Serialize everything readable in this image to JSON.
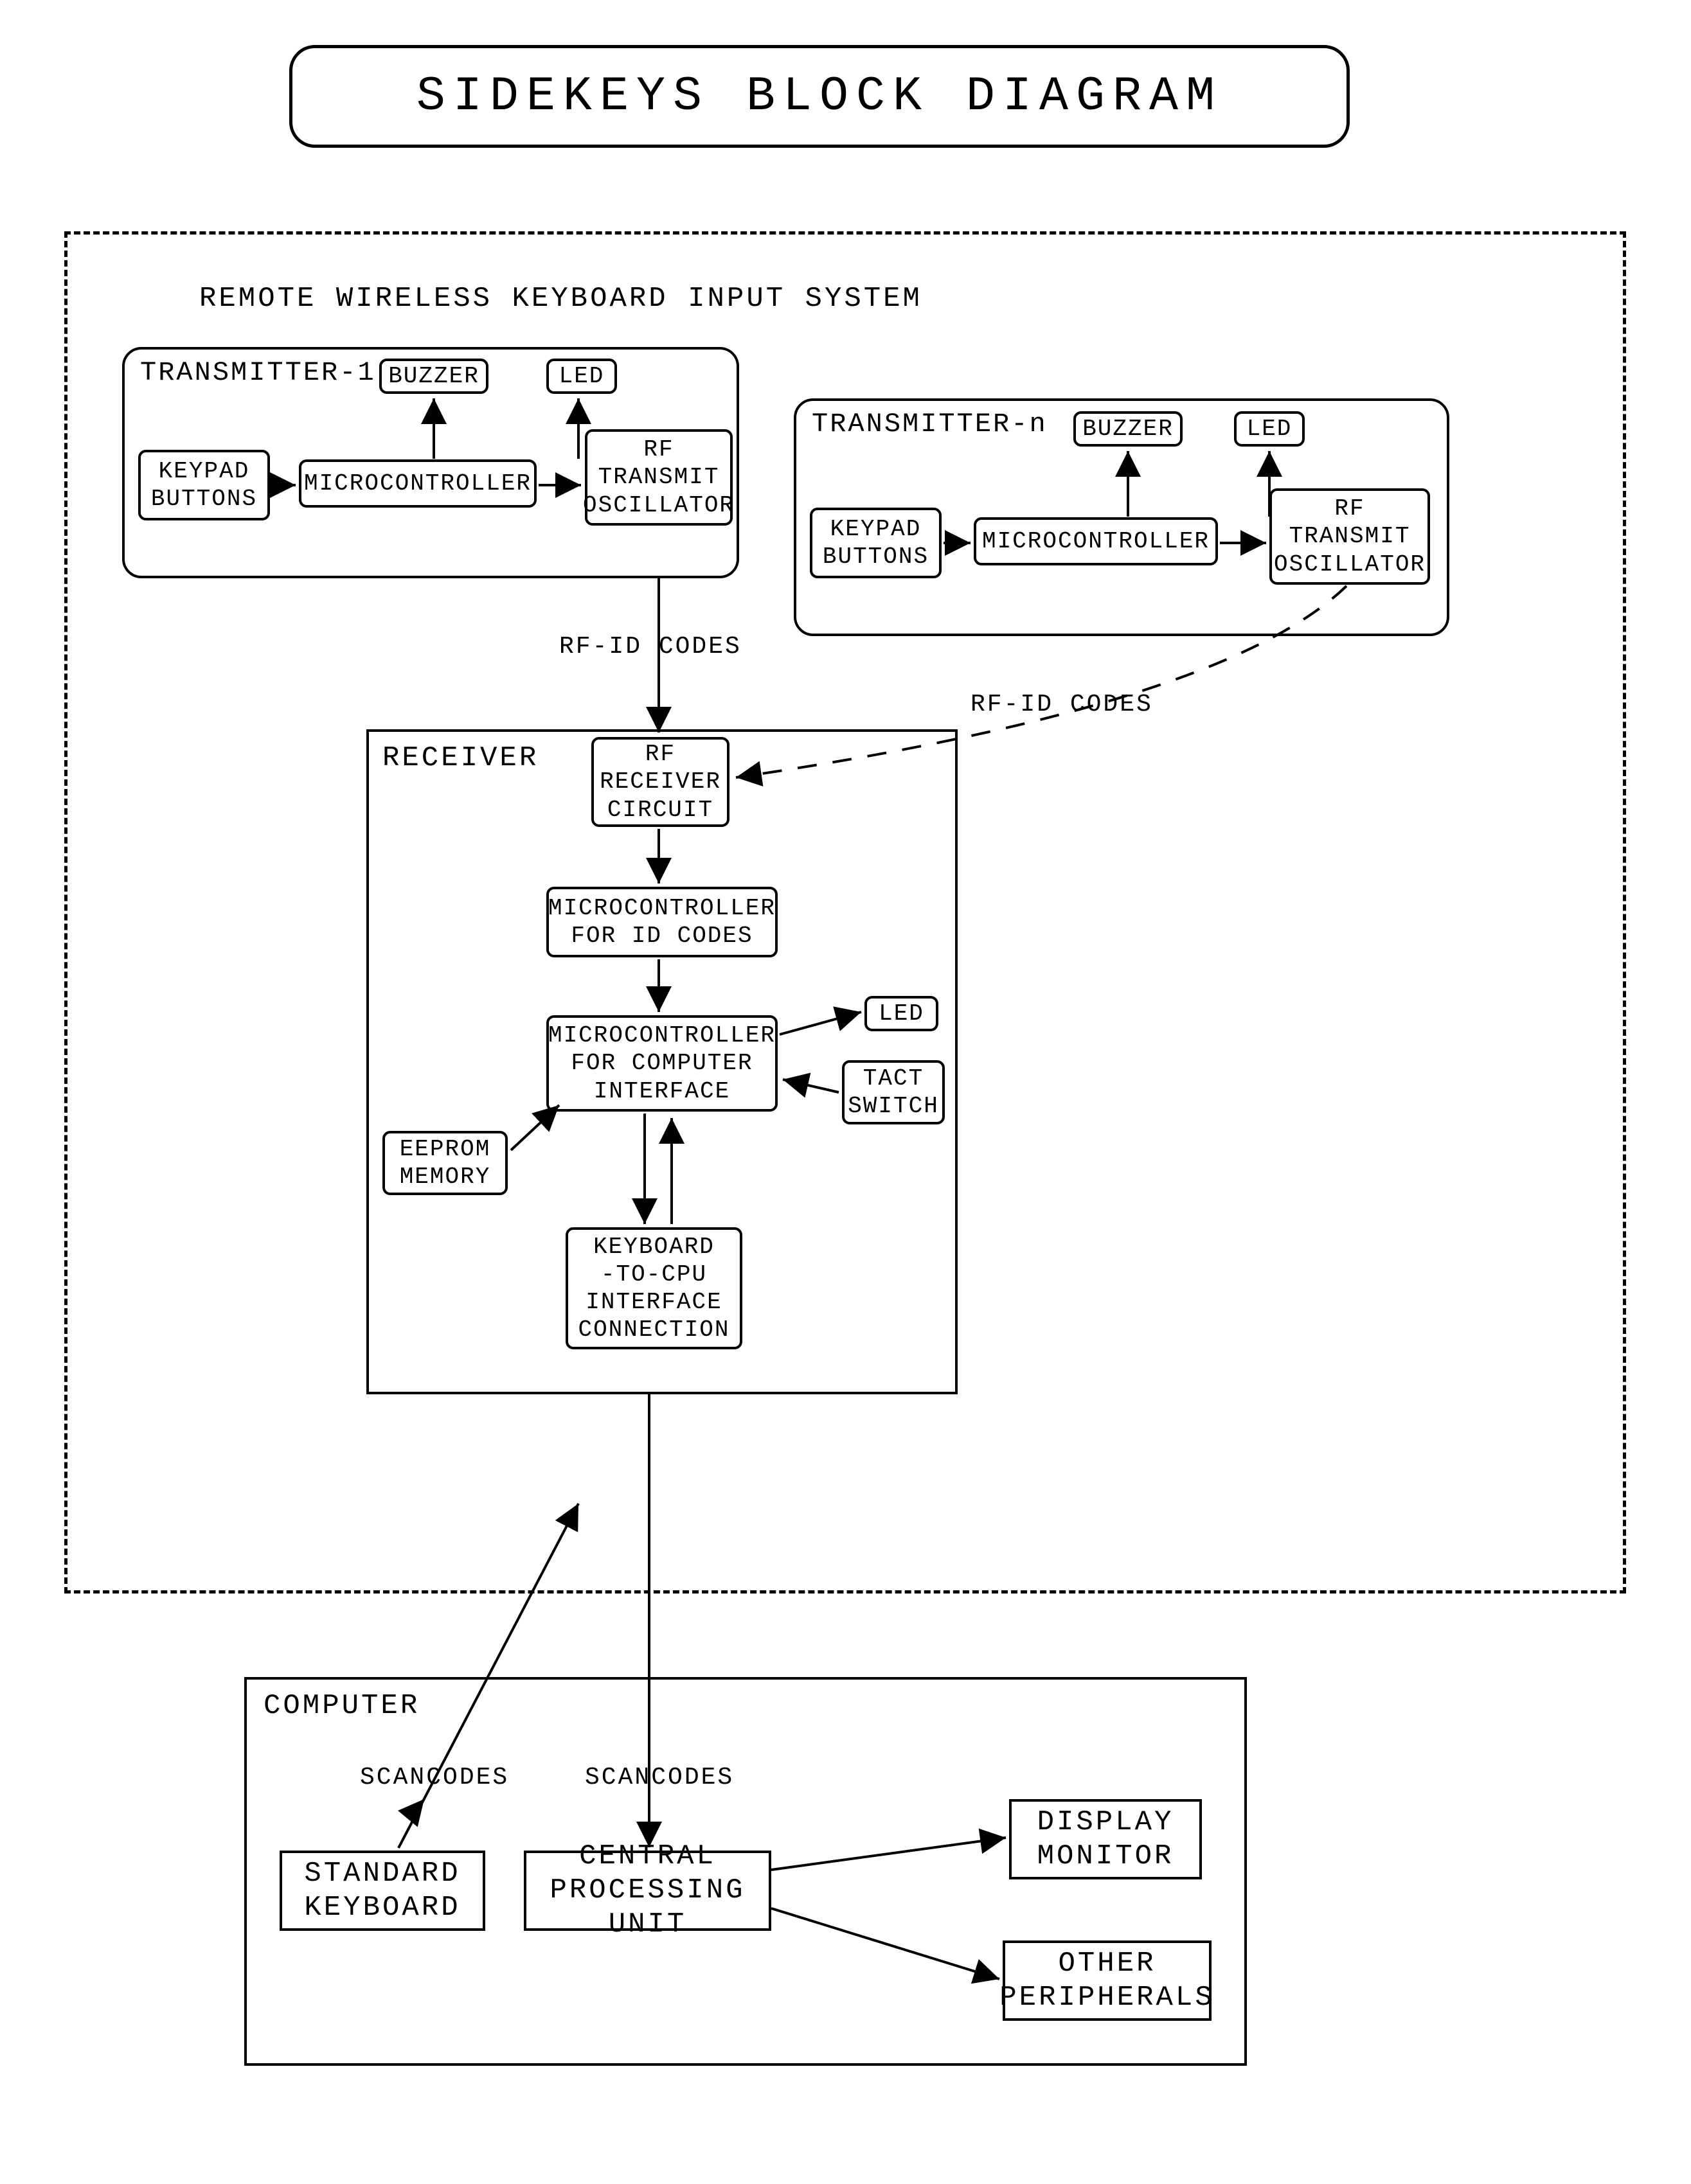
{
  "title": "SIDEKEYS BLOCK DIAGRAM",
  "systemLabel": "REMOTE WIRELESS KEYBOARD INPUT SYSTEM",
  "transmitter1": {
    "label": "TRANSMITTER-1",
    "buzzer": "BUZZER",
    "led": "LED",
    "keypad": "KEYPAD\nBUTTONS",
    "micro": "MICROCONTROLLER",
    "rf": "RF\nTRANSMIT\nOSCILLATOR"
  },
  "transmitterN": {
    "label": "TRANSMITTER-n",
    "buzzer": "BUZZER",
    "led": "LED",
    "keypad": "KEYPAD\nBUTTONS",
    "micro": "MICROCONTROLLER",
    "rf": "RF\nTRANSMIT\nOSCILLATOR"
  },
  "rfid1": "RF-ID CODES",
  "rfid2": "RF-ID CODES",
  "receiver": {
    "label": "RECEIVER",
    "rfcircuit": "RF\nRECEIVER\nCIRCUIT",
    "microId": "MICROCONTROLLER\nFOR ID CODES",
    "microInterface": "MICROCONTROLLER\nFOR COMPUTER\nINTERFACE",
    "led": "LED",
    "tact": "TACT\nSWITCH",
    "eeprom": "EEPROM\nMEMORY",
    "keyboardCpu": "KEYBOARD\n-TO-CPU\nINTERFACE\nCONNECTION"
  },
  "computer": {
    "label": "COMPUTER",
    "scancodes1": "SCANCODES",
    "scancodes2": "SCANCODES",
    "keyboard": "STANDARD\nKEYBOARD",
    "cpu": "CENTRAL\nPROCESSING UNIT",
    "display": "DISPLAY\nMONITOR",
    "peripherals": "OTHER\nPERIPHERALS"
  }
}
